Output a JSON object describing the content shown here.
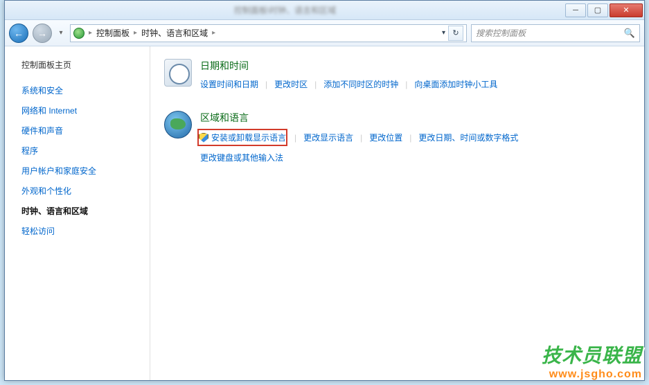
{
  "titlebar": {
    "blurred_title": "控制面板\\时钟、语言和区域"
  },
  "nav": {
    "breadcrumb": {
      "root": "控制面板",
      "current": "时钟、语言和区域"
    },
    "search_placeholder": "搜索控制面板"
  },
  "sidebar": {
    "title": "控制面板主页",
    "items": [
      {
        "label": "系统和安全",
        "active": false
      },
      {
        "label": "网络和 Internet",
        "active": false
      },
      {
        "label": "硬件和声音",
        "active": false
      },
      {
        "label": "程序",
        "active": false
      },
      {
        "label": "用户帐户和家庭安全",
        "active": false
      },
      {
        "label": "外观和个性化",
        "active": false
      },
      {
        "label": "时钟、语言和区域",
        "active": true
      },
      {
        "label": "轻松访问",
        "active": false
      }
    ]
  },
  "main": {
    "sections": [
      {
        "title": "日期和时间",
        "icon": "datetime-icon",
        "rows": [
          [
            {
              "label": "设置时间和日期",
              "highlight": false,
              "shield": false
            },
            {
              "label": "更改时区",
              "highlight": false,
              "shield": false
            },
            {
              "label": "添加不同时区的时钟",
              "highlight": false,
              "shield": false
            },
            {
              "label": "向桌面添加时钟小工具",
              "highlight": false,
              "shield": false
            }
          ]
        ]
      },
      {
        "title": "区域和语言",
        "icon": "region-icon",
        "rows": [
          [
            {
              "label": "安装或卸载显示语言",
              "highlight": true,
              "shield": true
            },
            {
              "label": "更改显示语言",
              "highlight": false,
              "shield": false
            },
            {
              "label": "更改位置",
              "highlight": false,
              "shield": false
            },
            {
              "label": "更改日期、时间或数字格式",
              "highlight": false,
              "shield": false
            }
          ],
          [
            {
              "label": "更改键盘或其他输入法",
              "highlight": false,
              "shield": false
            }
          ]
        ]
      }
    ]
  },
  "watermark": {
    "line1": "技术员联盟",
    "line2": "www.jsgho.com"
  }
}
